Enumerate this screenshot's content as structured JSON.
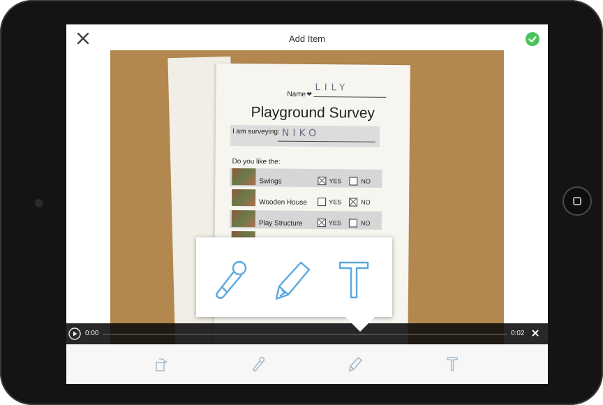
{
  "header": {
    "title": "Add Item",
    "close_icon": "close-icon",
    "done_icon": "checkmark-icon"
  },
  "photo": {
    "name_label": "Name",
    "name_value": "LILY",
    "survey_title": "Playground Survey",
    "surveying_label": "I am surveying:",
    "surveying_value": "NIKO",
    "question": "Do you like the:",
    "rows": [
      {
        "label": "Swings",
        "yes": "YES",
        "no": "NO",
        "checked": "yes"
      },
      {
        "label": "Wooden House",
        "yes": "YES",
        "no": "NO",
        "checked": "no"
      },
      {
        "label": "Play Structure",
        "yes": "YES",
        "no": "NO",
        "checked": "yes"
      }
    ]
  },
  "popup": {
    "tools": [
      "microphone-icon",
      "pencil-icon",
      "text-icon"
    ]
  },
  "player": {
    "time_start": "0:00",
    "time_end": "0:02"
  },
  "toolbar": {
    "tools": [
      "rotate-icon",
      "microphone-icon",
      "pencil-icon",
      "text-icon"
    ]
  },
  "colors": {
    "accent": "#5aa8e0",
    "done": "#4cc25c",
    "toolbar_icon": "#9db3c4"
  }
}
